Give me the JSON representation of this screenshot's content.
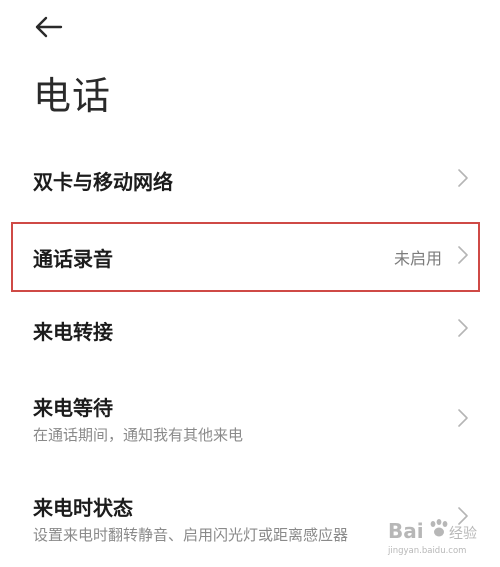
{
  "header": {
    "back_icon": "arrow-left-icon",
    "title": "电话"
  },
  "settings": [
    {
      "label": "双卡与移动网络",
      "value": "",
      "description": ""
    },
    {
      "label": "通话录音",
      "value": "未启用",
      "description": ""
    },
    {
      "label": "来电转接",
      "value": "",
      "description": ""
    },
    {
      "label": "来电等待",
      "value": "",
      "description": "在通话期间，通知我有其他来电"
    },
    {
      "label": "来电时状态",
      "value": "",
      "description": "设置来电时翻转静音、启用闪光灯或距离感应器"
    }
  ],
  "watermark": {
    "brand": "Bai",
    "brand_cn": "经验",
    "url": "jingyan.baidu.com"
  },
  "colors": {
    "background": "#ffffff",
    "text": "#1c1c1c",
    "secondary_text": "#8a8a8a",
    "highlight_border": "#cf4a46",
    "chevron": "#b5b5b5"
  }
}
